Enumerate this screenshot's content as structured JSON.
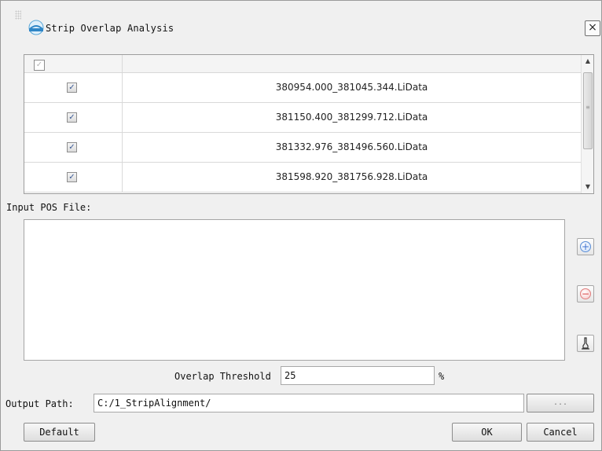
{
  "window": {
    "title": "Strip Overlap Analysis",
    "close_glyph": "×"
  },
  "file_table": {
    "header_checked": true,
    "rows": [
      {
        "checked": true,
        "file": "380954.000_381045.344.LiData"
      },
      {
        "checked": true,
        "file": "381150.400_381299.712.LiData"
      },
      {
        "checked": true,
        "file": "381332.976_381496.560.LiData"
      },
      {
        "checked": true,
        "file": "381598.920_381756.928.LiData"
      }
    ],
    "check_glyph": "✓"
  },
  "pos": {
    "label": "Input POS File:",
    "add_glyph": "+",
    "remove_glyph": "−",
    "clear_glyph": "🖌"
  },
  "threshold": {
    "label": "Overlap Threshold",
    "value": "25",
    "unit": "%"
  },
  "output": {
    "label": "Output Path:",
    "value": "C:/1_StripAlignment/",
    "browse_label": "..."
  },
  "buttons": {
    "default": "Default",
    "ok": "OK",
    "cancel": "Cancel"
  },
  "colors": {
    "add_accent": "#3a6fd0",
    "remove_accent": "#d94545",
    "background": "#f0f0f0"
  }
}
